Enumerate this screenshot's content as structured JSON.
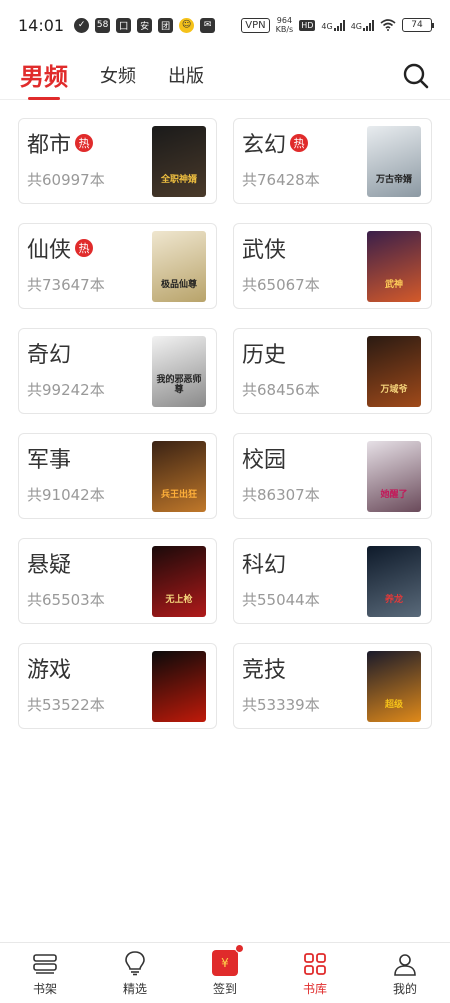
{
  "status_bar": {
    "time": "14:01",
    "notif_icons": [
      "58",
      "囗",
      "安",
      "团"
    ],
    "vpn": "VPN",
    "speed_value": "964",
    "speed_unit": "KB/s",
    "hd": "HD",
    "network": "4G",
    "network2": "4G",
    "battery": "74"
  },
  "top_nav": {
    "tabs": [
      {
        "label": "男频",
        "active": true
      },
      {
        "label": "女频",
        "active": false
      },
      {
        "label": "出版",
        "active": false
      }
    ]
  },
  "categories": [
    {
      "name": "都市",
      "hot": true,
      "count": "共60997本",
      "cover_title": "全职神婿",
      "cover_colors": [
        "#1a1a1a",
        "#4a3a2a"
      ],
      "title_color": "#f0c040"
    },
    {
      "name": "玄幻",
      "hot": true,
      "count": "共76428本",
      "cover_title": "万古帝婿",
      "cover_colors": [
        "#e8ecef",
        "#8c99a3"
      ],
      "title_color": "#222"
    },
    {
      "name": "仙侠",
      "hot": true,
      "count": "共73647本",
      "cover_title": "极品仙尊",
      "cover_colors": [
        "#efe6cf",
        "#b8a36a"
      ],
      "title_color": "#222"
    },
    {
      "name": "武侠",
      "hot": false,
      "count": "共65067本",
      "cover_title": "武神",
      "cover_colors": [
        "#3a1f4a",
        "#d45a2a"
      ],
      "title_color": "#ffcf5a"
    },
    {
      "name": "奇幻",
      "hot": false,
      "count": "共99242本",
      "cover_title": "我的邪恶师尊",
      "cover_colors": [
        "#f2f2f2",
        "#8a8a8a"
      ],
      "title_color": "#222"
    },
    {
      "name": "历史",
      "hot": false,
      "count": "共68456本",
      "cover_title": "万域爷",
      "cover_colors": [
        "#2a1a12",
        "#a04a1a"
      ],
      "title_color": "#f3d27a"
    },
    {
      "name": "军事",
      "hot": false,
      "count": "共91042本",
      "cover_title": "兵王出狂",
      "cover_colors": [
        "#3a2214",
        "#c0782a"
      ],
      "title_color": "#ffb03a"
    },
    {
      "name": "校园",
      "hot": false,
      "count": "共86307本",
      "cover_title": "她醒了",
      "cover_colors": [
        "#e6e0e6",
        "#6a4a5a"
      ],
      "title_color": "#c21a5a"
    },
    {
      "name": "悬疑",
      "hot": false,
      "count": "共65503本",
      "cover_title": "无上枪",
      "cover_colors": [
        "#1a0a0a",
        "#b01a1a"
      ],
      "title_color": "#f2d27a"
    },
    {
      "name": "科幻",
      "hot": false,
      "count": "共55044本",
      "cover_title": "养龙",
      "cover_colors": [
        "#0e1a2a",
        "#5a6a7a"
      ],
      "title_color": "#e03a3a"
    },
    {
      "name": "游戏",
      "hot": false,
      "count": "共53522本",
      "cover_title": "",
      "cover_colors": [
        "#0a0a0a",
        "#c01a0a"
      ],
      "title_color": "#ffffff"
    },
    {
      "name": "竞技",
      "hot": false,
      "count": "共53339本",
      "cover_title": "超级",
      "cover_colors": [
        "#1a1a2a",
        "#e08a1a"
      ],
      "title_color": "#f5c21a"
    }
  ],
  "bottom_nav": [
    {
      "label": "书架",
      "icon": "bookshelf-icon",
      "active": false
    },
    {
      "label": "精选",
      "icon": "lightbulb-icon",
      "active": false
    },
    {
      "label": "签到",
      "icon": "signin-redpacket-icon",
      "active": false
    },
    {
      "label": "书库",
      "icon": "grid-library-icon",
      "active": true
    },
    {
      "label": "我的",
      "icon": "user-icon",
      "active": false
    }
  ],
  "colors": {
    "accent": "#e02b2b",
    "muted": "#999999",
    "border": "#e6e6e6"
  }
}
